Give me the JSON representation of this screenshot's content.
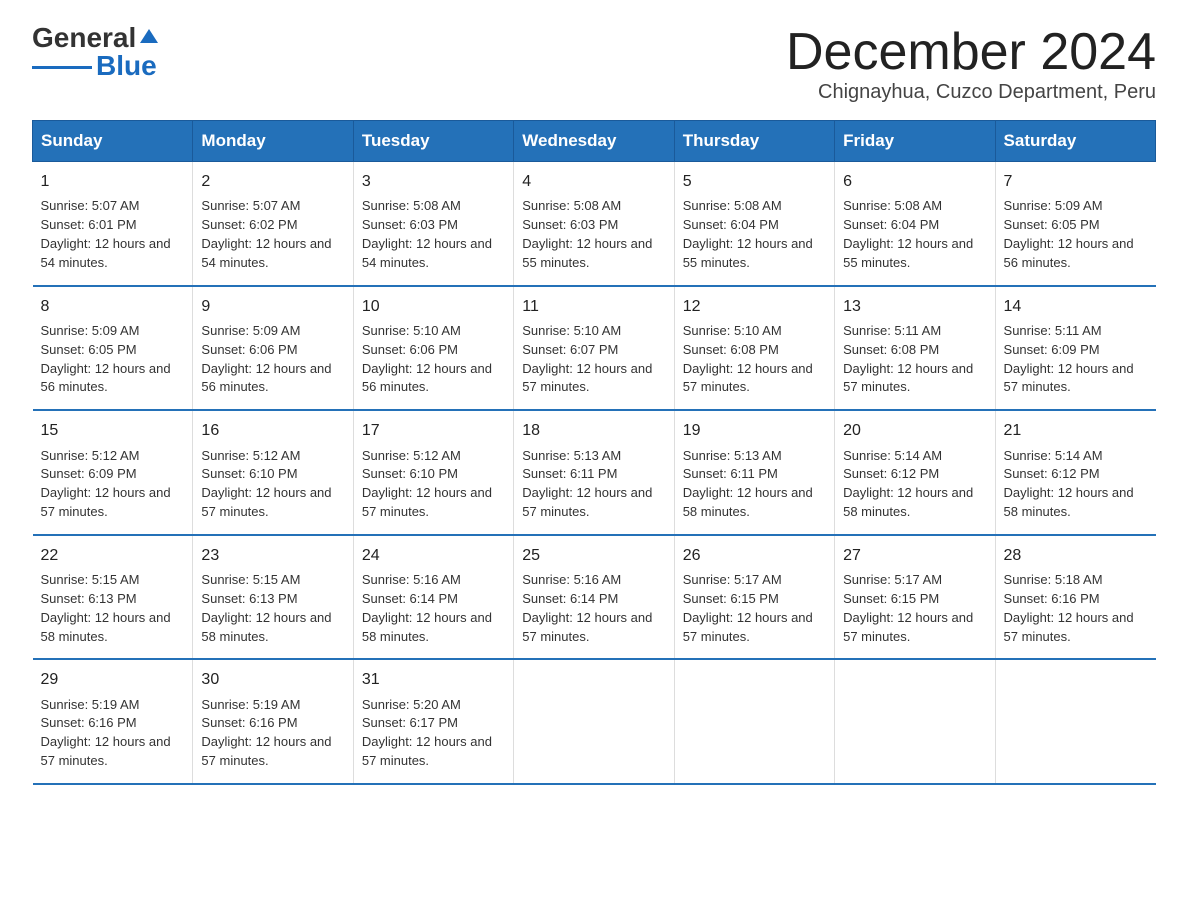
{
  "logo": {
    "text_general": "General",
    "text_blue": "Blue",
    "line_color": "#1a6bbf"
  },
  "title": "December 2024",
  "subtitle": "Chignayhua, Cuzco Department, Peru",
  "days_of_week": [
    "Sunday",
    "Monday",
    "Tuesday",
    "Wednesday",
    "Thursday",
    "Friday",
    "Saturday"
  ],
  "weeks": [
    [
      {
        "day": "1",
        "sunrise": "5:07 AM",
        "sunset": "6:01 PM",
        "daylight": "12 hours and 54 minutes."
      },
      {
        "day": "2",
        "sunrise": "5:07 AM",
        "sunset": "6:02 PM",
        "daylight": "12 hours and 54 minutes."
      },
      {
        "day": "3",
        "sunrise": "5:08 AM",
        "sunset": "6:03 PM",
        "daylight": "12 hours and 54 minutes."
      },
      {
        "day": "4",
        "sunrise": "5:08 AM",
        "sunset": "6:03 PM",
        "daylight": "12 hours and 55 minutes."
      },
      {
        "day": "5",
        "sunrise": "5:08 AM",
        "sunset": "6:04 PM",
        "daylight": "12 hours and 55 minutes."
      },
      {
        "day": "6",
        "sunrise": "5:08 AM",
        "sunset": "6:04 PM",
        "daylight": "12 hours and 55 minutes."
      },
      {
        "day": "7",
        "sunrise": "5:09 AM",
        "sunset": "6:05 PM",
        "daylight": "12 hours and 56 minutes."
      }
    ],
    [
      {
        "day": "8",
        "sunrise": "5:09 AM",
        "sunset": "6:05 PM",
        "daylight": "12 hours and 56 minutes."
      },
      {
        "day": "9",
        "sunrise": "5:09 AM",
        "sunset": "6:06 PM",
        "daylight": "12 hours and 56 minutes."
      },
      {
        "day": "10",
        "sunrise": "5:10 AM",
        "sunset": "6:06 PM",
        "daylight": "12 hours and 56 minutes."
      },
      {
        "day": "11",
        "sunrise": "5:10 AM",
        "sunset": "6:07 PM",
        "daylight": "12 hours and 57 minutes."
      },
      {
        "day": "12",
        "sunrise": "5:10 AM",
        "sunset": "6:08 PM",
        "daylight": "12 hours and 57 minutes."
      },
      {
        "day": "13",
        "sunrise": "5:11 AM",
        "sunset": "6:08 PM",
        "daylight": "12 hours and 57 minutes."
      },
      {
        "day": "14",
        "sunrise": "5:11 AM",
        "sunset": "6:09 PM",
        "daylight": "12 hours and 57 minutes."
      }
    ],
    [
      {
        "day": "15",
        "sunrise": "5:12 AM",
        "sunset": "6:09 PM",
        "daylight": "12 hours and 57 minutes."
      },
      {
        "day": "16",
        "sunrise": "5:12 AM",
        "sunset": "6:10 PM",
        "daylight": "12 hours and 57 minutes."
      },
      {
        "day": "17",
        "sunrise": "5:12 AM",
        "sunset": "6:10 PM",
        "daylight": "12 hours and 57 minutes."
      },
      {
        "day": "18",
        "sunrise": "5:13 AM",
        "sunset": "6:11 PM",
        "daylight": "12 hours and 57 minutes."
      },
      {
        "day": "19",
        "sunrise": "5:13 AM",
        "sunset": "6:11 PM",
        "daylight": "12 hours and 58 minutes."
      },
      {
        "day": "20",
        "sunrise": "5:14 AM",
        "sunset": "6:12 PM",
        "daylight": "12 hours and 58 minutes."
      },
      {
        "day": "21",
        "sunrise": "5:14 AM",
        "sunset": "6:12 PM",
        "daylight": "12 hours and 58 minutes."
      }
    ],
    [
      {
        "day": "22",
        "sunrise": "5:15 AM",
        "sunset": "6:13 PM",
        "daylight": "12 hours and 58 minutes."
      },
      {
        "day": "23",
        "sunrise": "5:15 AM",
        "sunset": "6:13 PM",
        "daylight": "12 hours and 58 minutes."
      },
      {
        "day": "24",
        "sunrise": "5:16 AM",
        "sunset": "6:14 PM",
        "daylight": "12 hours and 58 minutes."
      },
      {
        "day": "25",
        "sunrise": "5:16 AM",
        "sunset": "6:14 PM",
        "daylight": "12 hours and 57 minutes."
      },
      {
        "day": "26",
        "sunrise": "5:17 AM",
        "sunset": "6:15 PM",
        "daylight": "12 hours and 57 minutes."
      },
      {
        "day": "27",
        "sunrise": "5:17 AM",
        "sunset": "6:15 PM",
        "daylight": "12 hours and 57 minutes."
      },
      {
        "day": "28",
        "sunrise": "5:18 AM",
        "sunset": "6:16 PM",
        "daylight": "12 hours and 57 minutes."
      }
    ],
    [
      {
        "day": "29",
        "sunrise": "5:19 AM",
        "sunset": "6:16 PM",
        "daylight": "12 hours and 57 minutes."
      },
      {
        "day": "30",
        "sunrise": "5:19 AM",
        "sunset": "6:16 PM",
        "daylight": "12 hours and 57 minutes."
      },
      {
        "day": "31",
        "sunrise": "5:20 AM",
        "sunset": "6:17 PM",
        "daylight": "12 hours and 57 minutes."
      },
      null,
      null,
      null,
      null
    ]
  ]
}
